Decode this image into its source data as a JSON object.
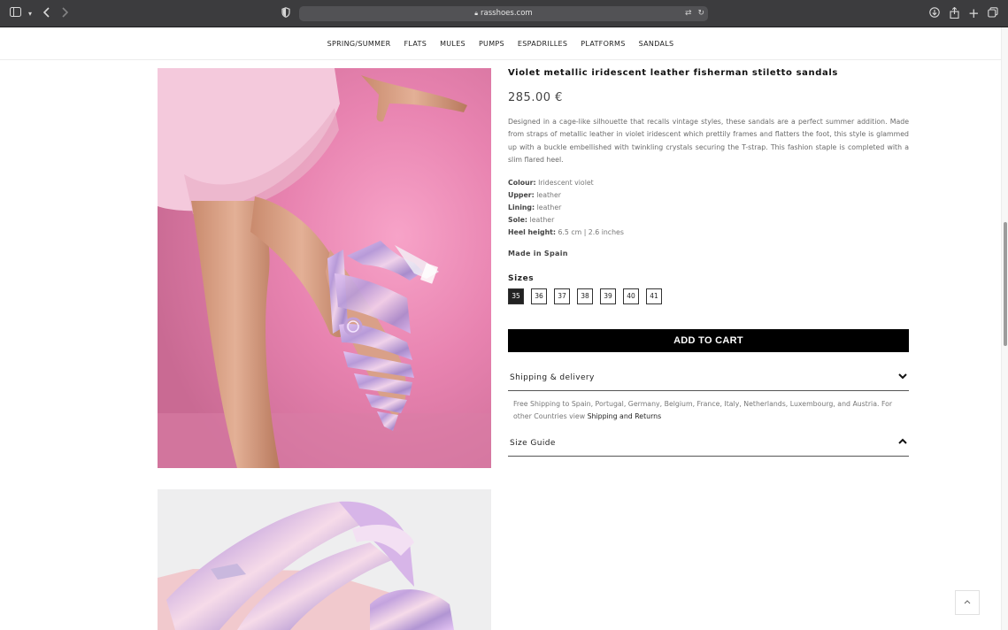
{
  "browser": {
    "url": "rasshoes.com",
    "icons": [
      "sidebar-icon",
      "chevron-down-icon",
      "back-icon",
      "forward-icon",
      "privacy-shield-icon",
      "translate-icon",
      "reload-icon",
      "download-icon",
      "share-icon",
      "new-tab-icon",
      "tabs-overview-icon"
    ]
  },
  "nav": {
    "items": [
      "SPRING/SUMMER",
      "FLATS",
      "MULES",
      "PUMPS",
      "ESPADRILLES",
      "PLATFORMS",
      "SANDALS"
    ]
  },
  "product": {
    "title": "Violet metallic iridescent leather fisherman stiletto sandals",
    "price": "285.00 €",
    "description": "Designed in a cage-like silhouette that recalls vintage styles, these sandals are a perfect summer addition. Made from straps of metallic leather in violet iridescent which prettily frames and flatters the foot, this style is glammed up with a buckle embellished with twinkling crystals securing the T-strap. This fashion staple is completed with a slim flared heel.",
    "specs": [
      {
        "label": "Colour:",
        "value": "Iridescent violet"
      },
      {
        "label": "Upper:",
        "value": "leather"
      },
      {
        "label": "Lining:",
        "value": "leather"
      },
      {
        "label": "Sole:",
        "value": "leather"
      },
      {
        "label": "Heel height:",
        "value": "6.5 cm | 2.6 inches"
      }
    ],
    "made_in": "Made in Spain",
    "sizes_label": "Sizes",
    "sizes": [
      "35",
      "36",
      "37",
      "38",
      "39",
      "40",
      "41"
    ],
    "selected_size": "35",
    "add_to_cart": "ADD TO CART"
  },
  "accordion": {
    "shipping": {
      "title": "Shipping & delivery",
      "text": "Free Shipping to Spain, Portugal, Germany, Belgium, France, Italy, Netherlands, Luxembourg, and Austria. For other Countries view",
      "link": "Shipping and Returns"
    },
    "size_guide": {
      "title": "Size Guide"
    }
  },
  "colors": {
    "browser_chrome": "#3c3c3e",
    "button_black": "#000000",
    "photo_background_pink": "#e889b2",
    "shoe_iridescent": "#c9a6e0"
  }
}
